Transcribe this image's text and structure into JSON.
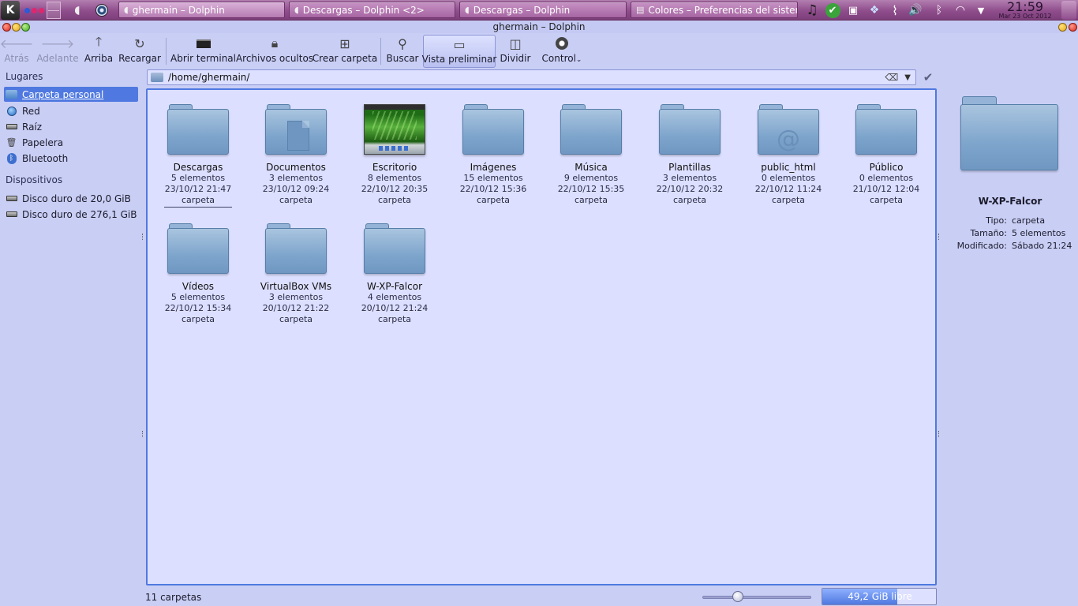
{
  "taskbar": {
    "tasks": [
      {
        "label": "ghermain – Dolphin"
      },
      {
        "label": "Descargas – Dolphin <2>"
      },
      {
        "label": "Descargas – Dolphin"
      },
      {
        "label": "Colores – Preferencias del sistema"
      }
    ],
    "clock_time": "21:59",
    "clock_date": "Mar 23 Oct 2012"
  },
  "window": {
    "title": "ghermain – Dolphin"
  },
  "toolbar": {
    "back": "Atrás",
    "forward": "Adelante",
    "up": "Arriba",
    "reload": "Recargar",
    "terminal": "Abrir terminal",
    "hidden_files": "Archivos ocultos",
    "new_folder": "Crear carpeta",
    "search": "Buscar",
    "preview": "Vista preliminar",
    "split": "Dividir",
    "control": "Control"
  },
  "places": {
    "header": "Lugares",
    "items": [
      {
        "label": "Carpeta personal"
      },
      {
        "label": "Red"
      },
      {
        "label": "Raíz"
      },
      {
        "label": "Papelera"
      },
      {
        "label": "Bluetooth"
      }
    ],
    "devices_header": "Dispositivos",
    "devices": [
      {
        "label": "Disco duro de 20,0 GiB"
      },
      {
        "label": "Disco duro de 276,1 GiB"
      }
    ]
  },
  "location": {
    "path": "/home/ghermain/"
  },
  "files": [
    {
      "name": "Descargas",
      "count": "5 elementos",
      "date": "23/10/12 21:47",
      "type": "carpeta"
    },
    {
      "name": "Documentos",
      "count": "3 elementos",
      "date": "23/10/12 09:24",
      "type": "carpeta"
    },
    {
      "name": "Escritorio",
      "count": "8 elementos",
      "date": "22/10/12 20:35",
      "type": "carpeta"
    },
    {
      "name": "Imágenes",
      "count": "15 elementos",
      "date": "22/10/12 15:36",
      "type": "carpeta"
    },
    {
      "name": "Música",
      "count": "9 elementos",
      "date": "22/10/12 15:35",
      "type": "carpeta"
    },
    {
      "name": "Plantillas",
      "count": "3 elementos",
      "date": "22/10/12 20:32",
      "type": "carpeta"
    },
    {
      "name": "public_html",
      "count": "0 elementos",
      "date": "22/10/12 11:24",
      "type": "carpeta"
    },
    {
      "name": "Público",
      "count": "0 elementos",
      "date": "21/10/12 12:04",
      "type": "carpeta"
    },
    {
      "name": "Vídeos",
      "count": "5 elementos",
      "date": "22/10/12 15:34",
      "type": "carpeta"
    },
    {
      "name": "VirtualBox VMs",
      "count": "3 elementos",
      "date": "20/10/12 21:22",
      "type": "carpeta"
    },
    {
      "name": "W-XP-Falcor",
      "count": "4 elementos",
      "date": "20/10/12 21:24",
      "type": "carpeta"
    }
  ],
  "info": {
    "name": "W-XP-Falcor",
    "type_label": "Tipo:",
    "type_value": "carpeta",
    "size_label": "Tamaño:",
    "size_value": "5 elementos",
    "modified_label": "Modificado:",
    "modified_value": "Sábado 21:24"
  },
  "status": {
    "text": "11 carpetas",
    "free_space": "49,2 GiB libre"
  },
  "colors": {
    "accent": "#4f79e0",
    "panel": "#c9cef5",
    "taskbar": "#8f4d8c"
  }
}
